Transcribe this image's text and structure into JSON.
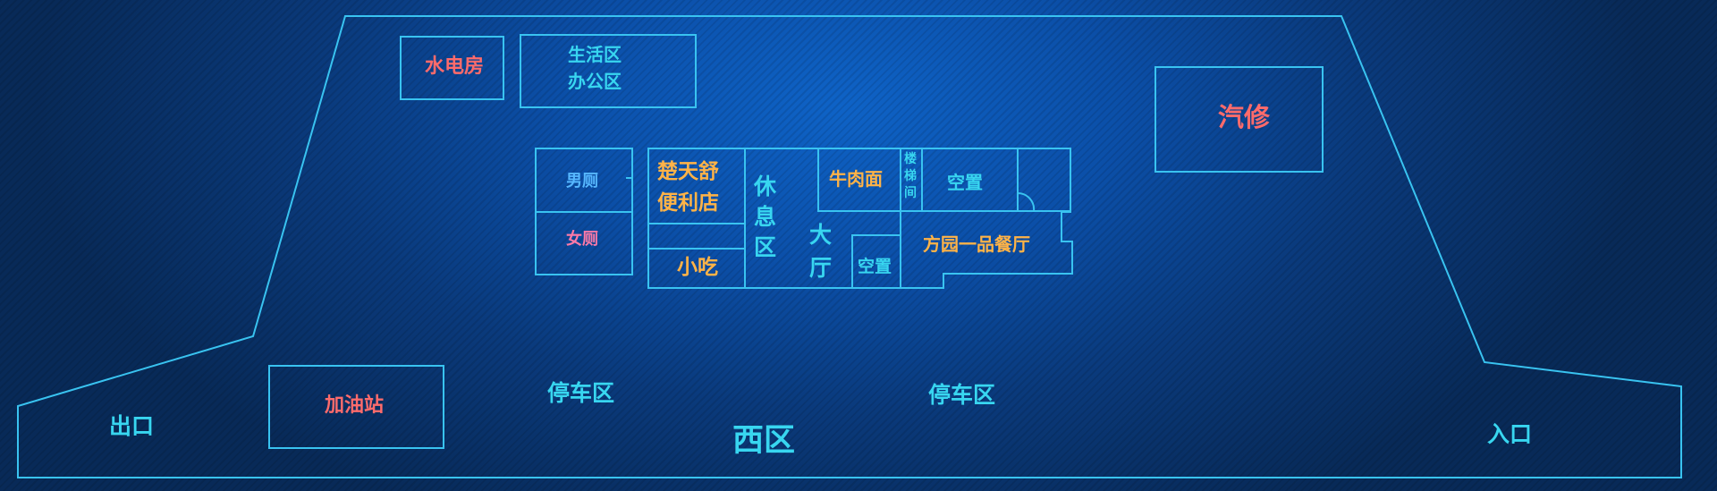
{
  "zone_name": "西区",
  "colors": {
    "background": "#0a3a7c",
    "outline": "#39c3f0",
    "label_default": "#38d6f0",
    "label_service": "#ff6b6b",
    "label_shop": "#ffb347",
    "label_female": "#ff7aa8",
    "label_male": "#57b8ff"
  },
  "areas": {
    "utility_room": "水电房",
    "living_office_line1": "生活区",
    "living_office_line2": "办公区",
    "auto_repair": "汽修",
    "gas_station": "加油站",
    "exit": "出口",
    "entrance": "入口",
    "parking_left": "停车区",
    "parking_right": "停车区"
  },
  "building": {
    "male_restroom": "男厕",
    "female_restroom": "女厕",
    "store_line1": "楚天舒",
    "store_line2": "便利店",
    "snacks": "小吃",
    "rest_area": [
      "休",
      "息",
      "区"
    ],
    "hall": [
      "大",
      "厅"
    ],
    "beef_noodles": "牛肉面",
    "stairwell": [
      "楼",
      "梯",
      "间"
    ],
    "vacant_upper": "空置",
    "vacant_lower": "空置",
    "restaurant": "方园一品餐厅"
  }
}
